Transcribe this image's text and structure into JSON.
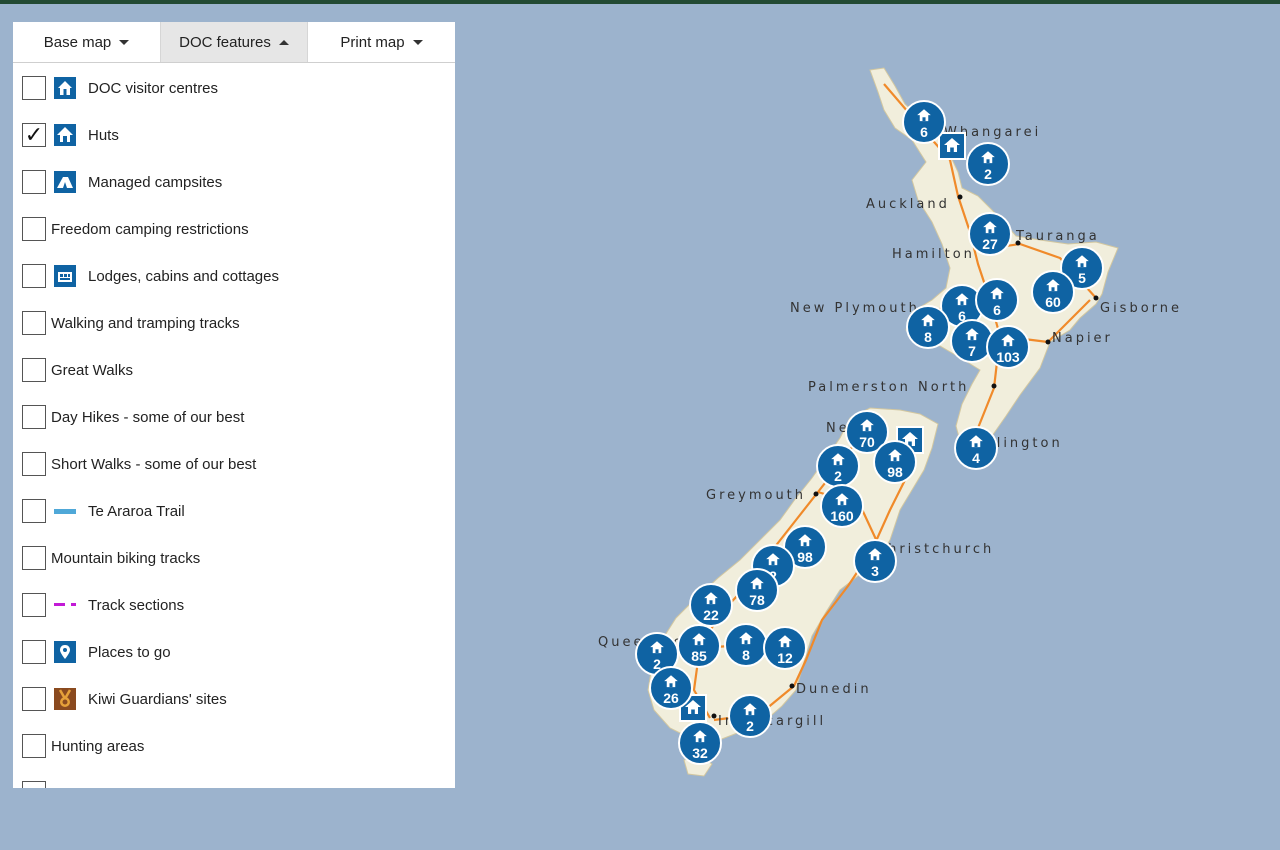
{
  "tabs": [
    {
      "label": "Base map",
      "state": "collapsed"
    },
    {
      "label": "DOC features",
      "state": "expanded"
    },
    {
      "label": "Print map",
      "state": "collapsed"
    }
  ],
  "features": [
    {
      "label": "DOC visitor centres",
      "checked": false,
      "icon": "visitor-centre-icon"
    },
    {
      "label": "Huts",
      "checked": true,
      "icon": "hut-icon"
    },
    {
      "label": "Managed campsites",
      "checked": false,
      "icon": "campsite-icon"
    },
    {
      "label": "Freedom camping restrictions",
      "checked": false,
      "icon": null
    },
    {
      "label": "Lodges, cabins and cottages",
      "checked": false,
      "icon": "lodge-icon"
    },
    {
      "label": "Walking and tramping tracks",
      "checked": false,
      "icon": null
    },
    {
      "label": "Great Walks",
      "checked": false,
      "icon": null
    },
    {
      "label": "Day Hikes - some of our best",
      "checked": false,
      "icon": null
    },
    {
      "label": "Short Walks - some of our best",
      "checked": false,
      "icon": null
    },
    {
      "label": "Te Araroa Trail",
      "checked": false,
      "icon": "trail-line-icon"
    },
    {
      "label": "Mountain biking tracks",
      "checked": false,
      "icon": null
    },
    {
      "label": "Track sections",
      "checked": false,
      "icon": "dashed-line-icon"
    },
    {
      "label": "Places to go",
      "checked": false,
      "icon": "place-pin-icon"
    },
    {
      "label": "Kiwi Guardians' sites",
      "checked": false,
      "icon": "medal-icon"
    },
    {
      "label": "Hunting areas",
      "checked": false,
      "icon": null
    }
  ],
  "cities": [
    "Whangarei",
    "Auckland",
    "Tauranga",
    "Hamilton",
    "Gisborne",
    "New Plymouth",
    "Napier",
    "Palmerston North",
    "Nelson",
    "Wellington",
    "Greymouth",
    "Christchurch",
    "Queenstown",
    "Dunedin",
    "Invercargill"
  ],
  "hut_clusters": [
    6,
    2,
    27,
    5,
    60,
    6,
    6,
    8,
    7,
    103,
    70,
    4,
    2,
    98,
    160,
    98,
    2,
    3,
    78,
    22,
    85,
    8,
    12,
    2,
    26,
    2,
    32
  ],
  "colors": {
    "sea": "#9cb3cd",
    "land": "#f1eedc",
    "road": "#f08a2a",
    "marker": "#0f63a3",
    "topbar": "#234a33"
  }
}
